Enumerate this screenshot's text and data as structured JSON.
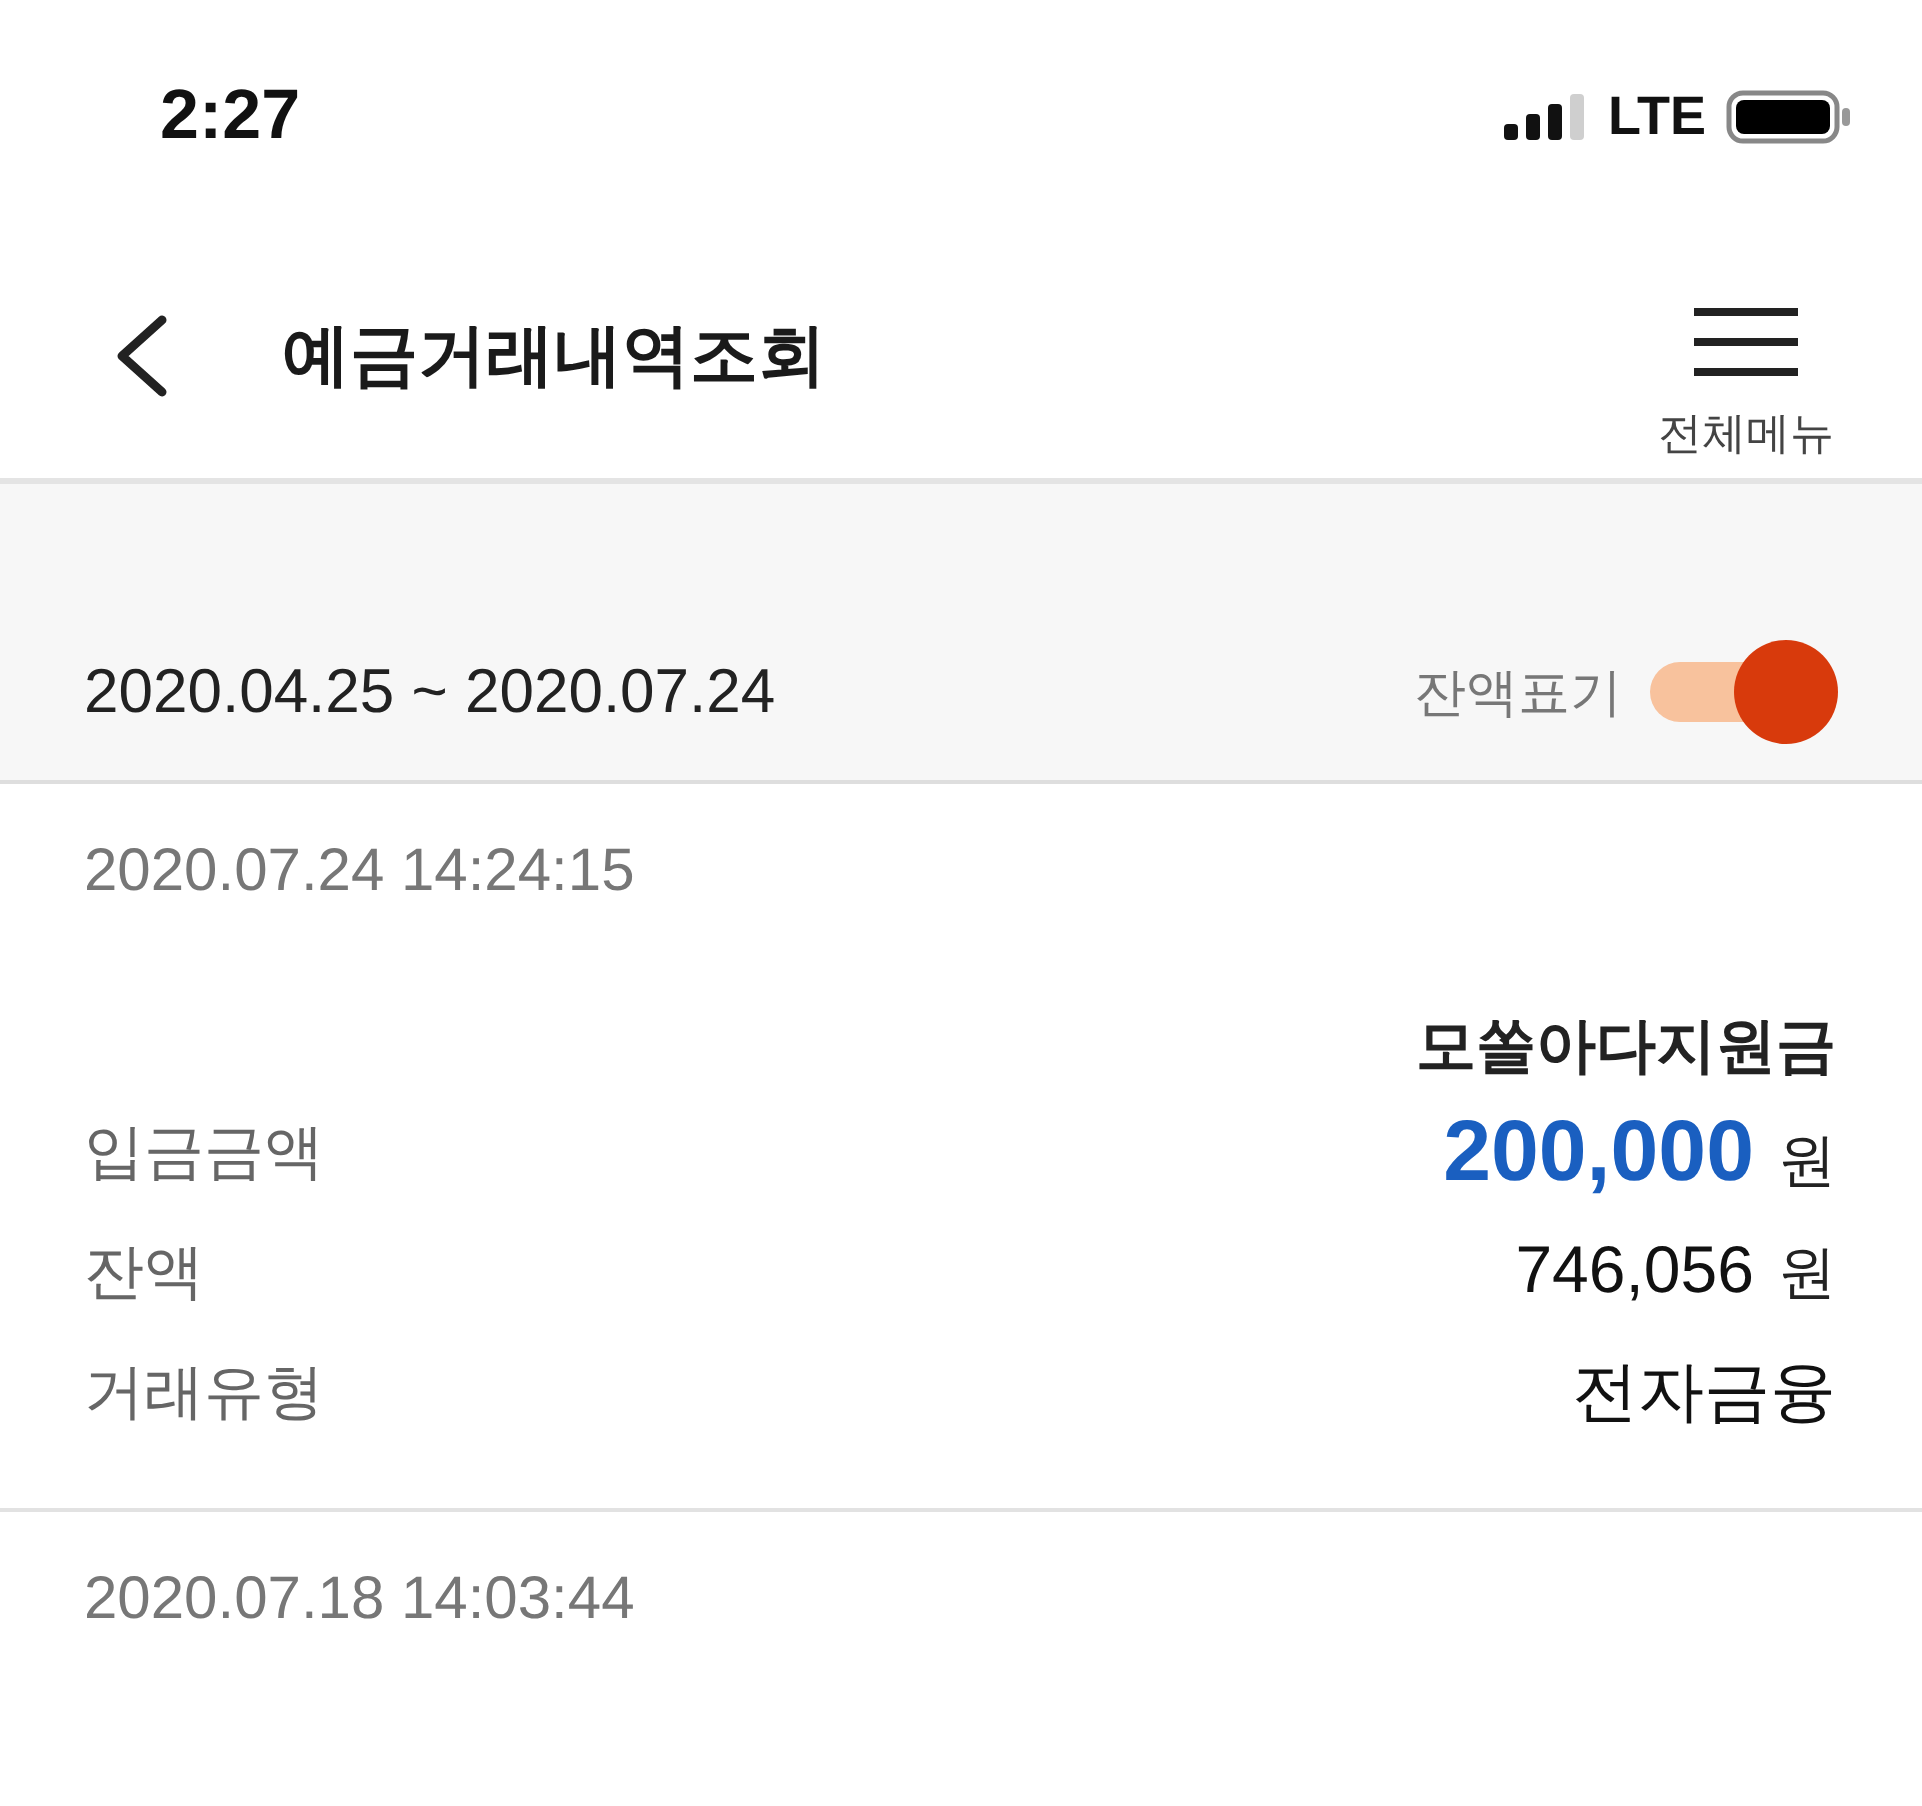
{
  "status_bar": {
    "time": "2:27",
    "network": "LTE"
  },
  "header": {
    "title": "예금거래내역조회",
    "menu_label": "전체메뉴"
  },
  "filter": {
    "date_range": "2020.04.25 ~ 2020.07.24",
    "balance_toggle": {
      "label": "잔액표기",
      "on": true
    }
  },
  "transactions": [
    {
      "datetime": "2020.07.24 14:24:15",
      "description": "모쏠아다지원금",
      "fields": [
        {
          "kind": "amount",
          "label": "입금금액",
          "value": "200,000",
          "unit": "원"
        },
        {
          "kind": "plain",
          "label": "잔액",
          "value": "746,056",
          "unit": "원"
        },
        {
          "kind": "plain",
          "label": "거래유형",
          "value": "전자금융"
        }
      ]
    },
    {
      "datetime": "2020.07.18 14:03:44"
    }
  ]
}
